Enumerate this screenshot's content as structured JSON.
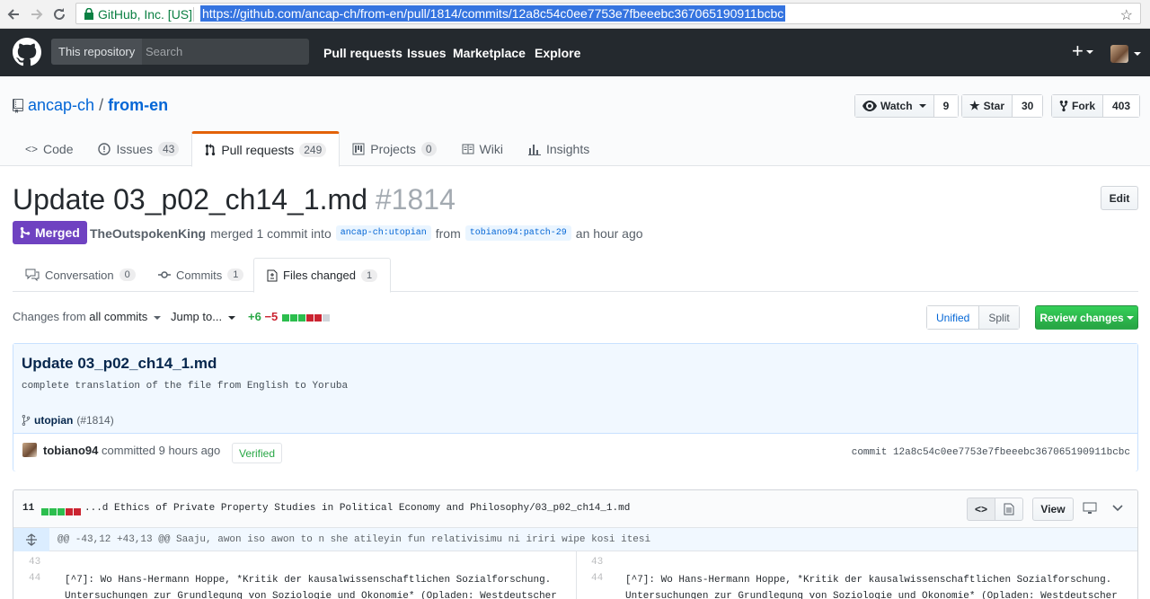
{
  "browser": {
    "secure_label": "GitHub, Inc. [US]",
    "url": "https://github.com/ancap-ch/from-en/pull/1814/commits/12a8c54c0ee7753e7fbeeebc367065190911bcbc"
  },
  "header": {
    "scope_label": "This repository",
    "search_placeholder": "Search",
    "nav": [
      "Pull requests",
      "Issues",
      "Marketplace",
      "Explore"
    ],
    "plus": "+"
  },
  "repo": {
    "owner": "ancap-ch",
    "separator": "/",
    "name": "from-en",
    "watch_label": "Watch",
    "watch_count": "9",
    "star_label": "Star",
    "star_count": "30",
    "fork_label": "Fork",
    "fork_count": "403",
    "tabs": [
      {
        "label": "Code",
        "count": ""
      },
      {
        "label": "Issues",
        "count": "43"
      },
      {
        "label": "Pull requests",
        "count": "249"
      },
      {
        "label": "Projects",
        "count": "0"
      },
      {
        "label": "Wiki",
        "count": ""
      },
      {
        "label": "Insights",
        "count": ""
      }
    ]
  },
  "pr": {
    "title": "Update 03_p02_ch14_1.md",
    "number": "#1814",
    "edit_label": "Edit",
    "state": "Merged",
    "author": "TheOutspokenKing",
    "action": "merged 1 commit into",
    "base_branch": "ancap-ch:utopian",
    "from_word": "from",
    "head_branch": "tobiano94:patch-29",
    "time": "an hour ago",
    "tabs": [
      {
        "label": "Conversation",
        "count": "0"
      },
      {
        "label": "Commits",
        "count": "1"
      },
      {
        "label": "Files changed",
        "count": "1"
      }
    ]
  },
  "toolbar": {
    "changes_from_prefix": "Changes from",
    "changes_from_value": "all commits",
    "jump_to": "Jump to...",
    "additions": "+6",
    "deletions": "−5",
    "unified": "Unified",
    "split": "Split",
    "review": "Review changes"
  },
  "commit": {
    "title": "Update 03_p02_ch14_1.md",
    "description": "complete translation of the file from English to Yoruba",
    "branch": "utopian",
    "pr_ref": "(#1814)",
    "author": "tobiano94",
    "committed": "committed 9 hours ago",
    "verified": "Verified",
    "sha_label": "commit",
    "sha": "12a8c54c0ee7753e7fbeeebc367065190911bcbc"
  },
  "file": {
    "changes": "11",
    "path": "...d Ethics of Private Property Studies in Political Economy and Philosophy/03_p02_ch14_1.md",
    "view_label": "View",
    "hunk": "@@ -43,12 +43,13 @@ Saaju, awon iso awon to n she atileyin fun relativisimu ni iriri wipe kosi itesi",
    "rows": [
      {
        "left_ln": "43",
        "left": "",
        "right_ln": "43",
        "right": ""
      },
      {
        "left_ln": "44",
        "left": "[^7]: Wo Hans-Hermann Hoppe, *Kritik der kausalwissenschaftlichen Sozialforschung.",
        "right_ln": "44",
        "right": "[^7]: Wo Hans-Hermann Hoppe, *Kritik der kausalwissenschaftlichen Sozialforschung."
      },
      {
        "left_ln": "",
        "left": "Untersuchungen zur Grundlegung von Soziologie und Ökonomie* (Opladen: Westdeutscher",
        "right_ln": "",
        "right": "Untersuchungen zur Grundlegung von Soziologie und Ökonomie* (Opladen: Westdeutscher"
      }
    ]
  },
  "colors": {
    "header_bg": "#24292e",
    "merged": "#6f42c1",
    "accent_link": "#0366d6",
    "review_green": "#28a745",
    "tab_highlight": "#e36209"
  }
}
